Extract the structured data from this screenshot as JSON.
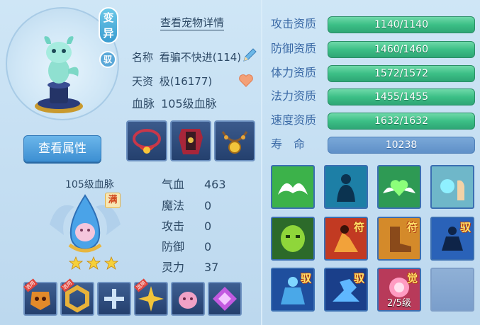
{
  "pet": {
    "mutant_tag": [
      "变",
      "异"
    ],
    "tame_badge": "驭",
    "view_attr_button": "查看属性",
    "detail_link": "查看宠物详情",
    "name_label": "名称",
    "name_value": "看骗不快进(114)",
    "talent_label": "天资",
    "talent_value": "极(16177)",
    "bloodline_label": "血脉",
    "bloodline_value": "105级血脉"
  },
  "bloodline_panel": {
    "title": "105级血脉",
    "full_tag": "满",
    "stars": 3
  },
  "attributes": [
    {
      "label": "气血",
      "value": "463"
    },
    {
      "label": "魔法",
      "value": "0"
    },
    {
      "label": "攻击",
      "value": "0"
    },
    {
      "label": "防御",
      "value": "0"
    },
    {
      "label": "灵力",
      "value": "37"
    }
  ],
  "bottom_slots": {
    "apply_tag": "选用",
    "items": [
      "gold-mask-item-icon",
      "gold-ring-item-icon",
      "add-slot-icon",
      "gold-burst-item-icon",
      "pink-beast-item-icon",
      "purple-crystal-item-icon"
    ]
  },
  "equipment": [
    "red-necklace-icon",
    "red-armor-icon",
    "gold-collar-icon"
  ],
  "aptitudes": [
    {
      "label": "攻击资质",
      "value": "1140/1140"
    },
    {
      "label": "防御资质",
      "value": "1460/1460"
    },
    {
      "label": "体力资质",
      "value": "1572/1572"
    },
    {
      "label": "法力资质",
      "value": "1455/1455"
    },
    {
      "label": "速度资质",
      "value": "1632/1632"
    }
  ],
  "life": {
    "label": "寿　命",
    "value": "10238"
  },
  "skills": [
    {
      "icon": "white-wings-skill-icon",
      "mark": ""
    },
    {
      "icon": "blue-silhouette-skill-icon",
      "mark": ""
    },
    {
      "icon": "green-heart-wings-skill-icon",
      "mark": ""
    },
    {
      "icon": "spirit-hand-skill-icon",
      "mark": ""
    },
    {
      "icon": "green-mask-skill-icon",
      "mark": ""
    },
    {
      "icon": "red-warrior-skill-icon",
      "mark": "符"
    },
    {
      "icon": "boot-skill-icon",
      "mark": "符"
    },
    {
      "icon": "meditation-skill-icon",
      "mark": "驭"
    },
    {
      "icon": "blue-giant-skill-icon",
      "mark": "驭"
    },
    {
      "icon": "running-figure-skill-icon",
      "mark": "驭"
    },
    {
      "icon": "pink-awaken-skill-icon",
      "mark": "觉",
      "level": "2/5级"
    },
    {
      "icon": "",
      "mark": ""
    }
  ],
  "colors": {
    "aptitude_bar": "#3cbf86",
    "life_bar": "#6b9bd0",
    "label_blue": "#3b6aa6",
    "background": "#c4def2"
  }
}
